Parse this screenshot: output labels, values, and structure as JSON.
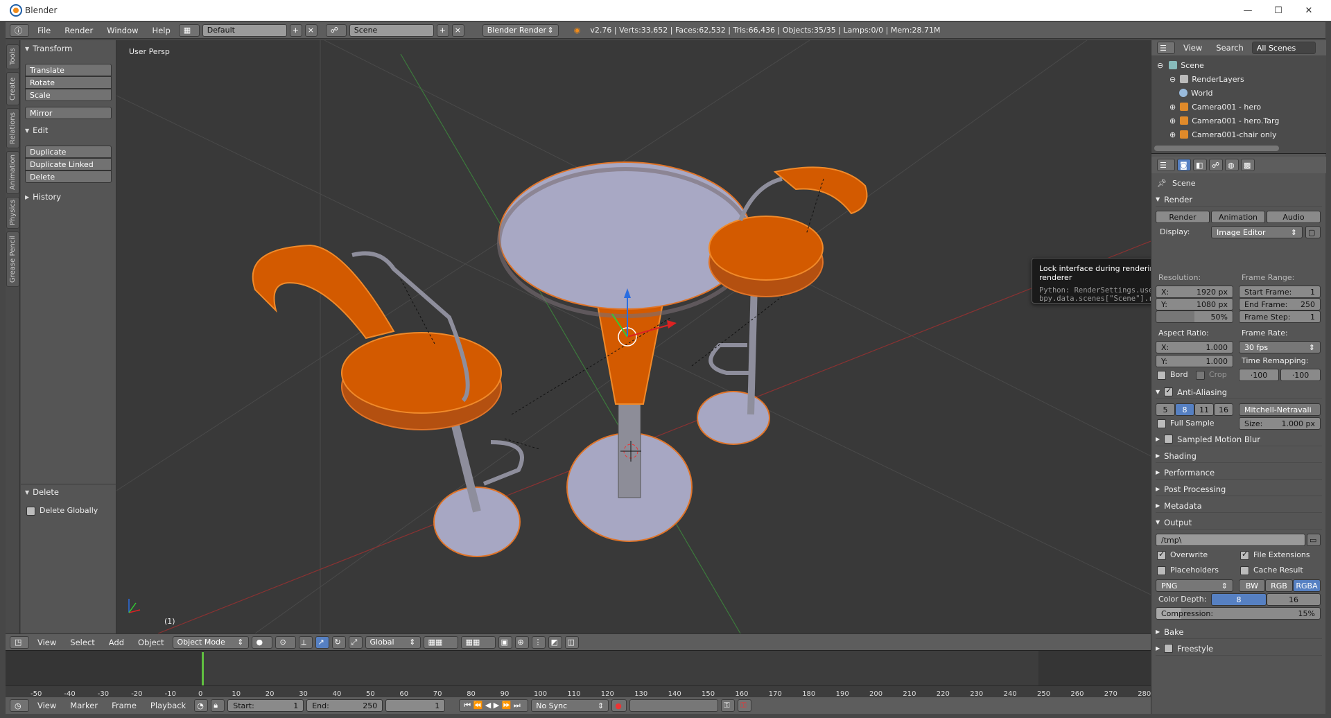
{
  "window": {
    "title": "Blender",
    "controls": [
      "—",
      "☐",
      "✕"
    ]
  },
  "topbar": {
    "menus": [
      "File",
      "Render",
      "Window",
      "Help"
    ],
    "layout": "Default",
    "scene": "Scene",
    "engine": "Blender Render",
    "stats": "v2.76 | Verts:33,652 | Faces:62,532 | Tris:66,436 | Objects:35/35 | Lamps:0/0 | Mem:28.71M"
  },
  "lefttabs": [
    "Tools",
    "Create",
    "Relations",
    "Animation",
    "Physics",
    "Grease Pencil"
  ],
  "toolshelf": {
    "transform": {
      "title": "Transform",
      "buttons": [
        "Translate",
        "Rotate",
        "Scale",
        "Mirror"
      ]
    },
    "edit": {
      "title": "Edit",
      "buttons": [
        "Duplicate",
        "Duplicate Linked",
        "Delete"
      ]
    },
    "history": "History",
    "operator": {
      "title": "Delete",
      "option": "Delete Globally"
    }
  },
  "viewport": {
    "label": "User Persp",
    "frame_indicator": "(1)"
  },
  "viewheader": {
    "menus": [
      "View",
      "Select",
      "Add",
      "Object"
    ],
    "mode": "Object Mode",
    "orientation": "Global"
  },
  "timeline": {
    "ticks": [
      "-50",
      "-40",
      "-30",
      "-20",
      "-10",
      "0",
      "10",
      "20",
      "30",
      "40",
      "50",
      "60",
      "70",
      "80",
      "90",
      "100",
      "110",
      "120",
      "130",
      "140",
      "150",
      "160",
      "170",
      "180",
      "190",
      "200",
      "210",
      "220",
      "230",
      "240",
      "250",
      "260",
      "270",
      "280"
    ],
    "menus": [
      "View",
      "Marker",
      "Frame",
      "Playback"
    ],
    "start_label": "Start:",
    "start": "1",
    "end_label": "End:",
    "end": "250",
    "current": "1",
    "sync": "No Sync"
  },
  "outliner": {
    "menus": [
      "View",
      "Search"
    ],
    "filter": "All Scenes",
    "items": [
      "Scene",
      "RenderLayers",
      "World",
      "Camera001 - hero",
      "Camera001 - hero.Targ",
      "Camera001-chair only"
    ]
  },
  "properties": {
    "context": "Scene",
    "render": {
      "title": "Render",
      "buttons": [
        "Render",
        "Animation",
        "Audio"
      ],
      "display_label": "Display:",
      "display": "Image Editor"
    },
    "tooltip": {
      "text": "Lock interface during rendering in favor of giving more memory to the renderer",
      "python1": "Python: RenderSettings.use_lock_interface",
      "python2": "bpy.data.scenes[\"Scene\"].render.use_lock_interface"
    },
    "dimensions": {
      "resolution_label": "Resolution:",
      "frame_range_label": "Frame Range:",
      "x_label": "X:",
      "x": "1920 px",
      "y_label": "Y:",
      "y": "1080 px",
      "pct": "50%",
      "start_label": "Start Frame:",
      "start": "1",
      "end_label": "End Frame:",
      "end": "250",
      "step_label": "Frame Step:",
      "step": "1",
      "aspect_label": "Aspect Ratio:",
      "ax": "1.000",
      "ay": "1.000",
      "fps_label": "Frame Rate:",
      "fps": "30 fps",
      "remap_label": "Time Remapping:",
      "remap_old": "·100",
      "remap_new": "·100",
      "bord": "Bord",
      "crop": "Crop"
    },
    "aa": {
      "title": "Anti-Aliasing",
      "samples": [
        "5",
        "8",
        "11",
        "16"
      ],
      "active": "8",
      "filter": "Mitchell-Netravali",
      "full_sample": "Full Sample",
      "size_label": "Size:",
      "size": "1.000 px"
    },
    "collapsed": [
      "Sampled Motion Blur",
      "Shading",
      "Performance",
      "Post Processing",
      "Metadata"
    ],
    "output": {
      "title": "Output",
      "path": "/tmp\\",
      "overwrite": "Overwrite",
      "file_ext": "File Extensions",
      "placeholders": "Placeholders",
      "cache": "Cache Result",
      "format": "PNG",
      "color_modes": [
        "BW",
        "RGB",
        "RGBA"
      ],
      "depth_label": "Color Depth:",
      "depths": [
        "8",
        "16"
      ],
      "compression_label": "Compression:",
      "compression": "15%"
    },
    "bake": "Bake",
    "freestyle": "Freestyle"
  },
  "colors": {
    "selected": "#d35a00",
    "selected_outline": "#f08a2a",
    "active_blue": "#5680c2"
  }
}
